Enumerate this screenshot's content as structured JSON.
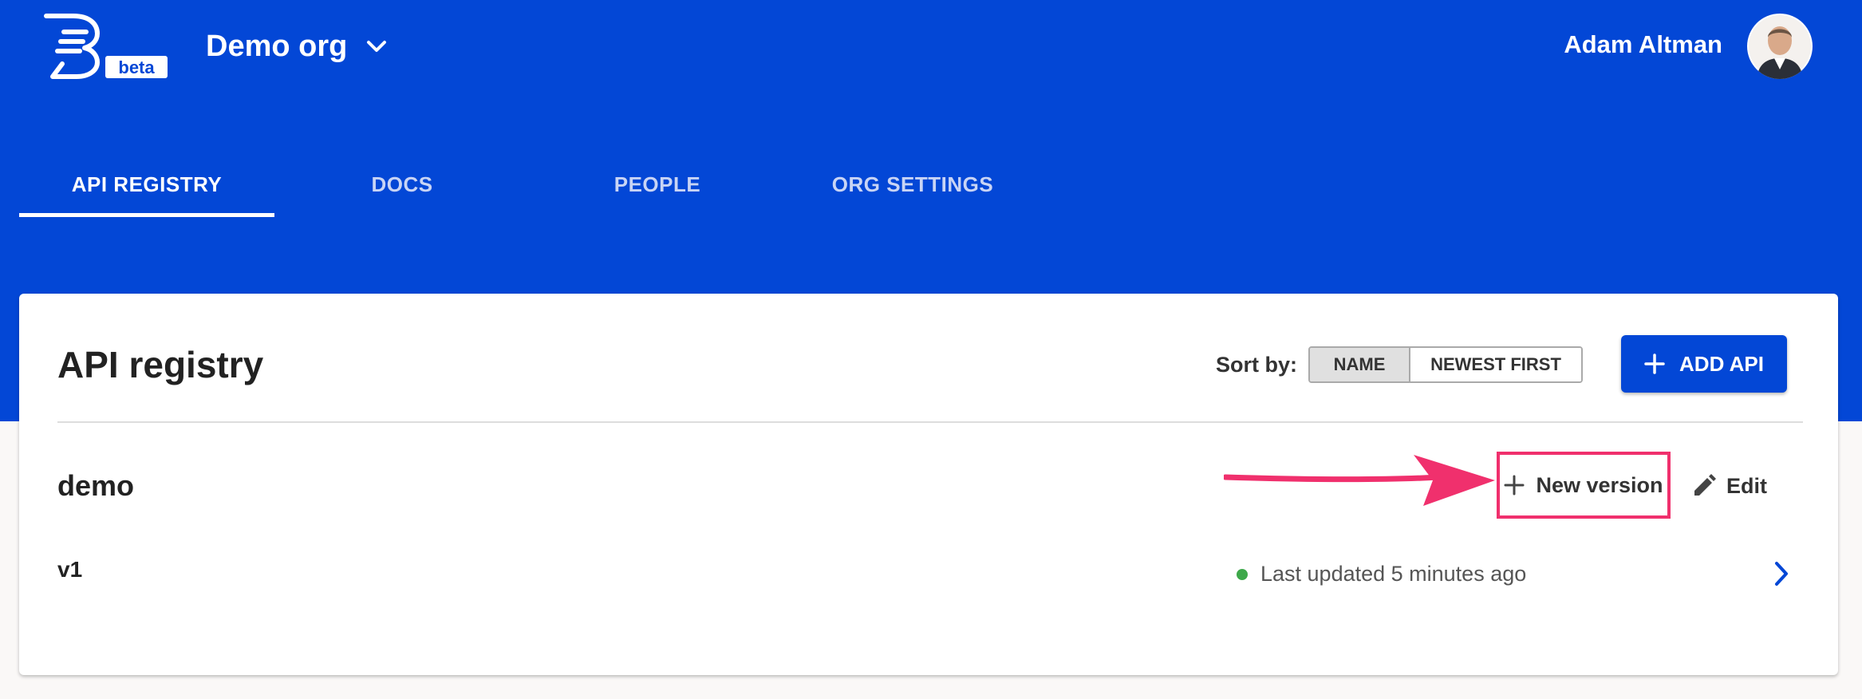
{
  "header": {
    "logo_badge": "beta",
    "org_name": "Demo org",
    "user_name": "Adam Altman"
  },
  "tabs": [
    {
      "label": "API REGISTRY",
      "active": true
    },
    {
      "label": "DOCS",
      "active": false
    },
    {
      "label": "PEOPLE",
      "active": false
    },
    {
      "label": "ORG SETTINGS",
      "active": false
    }
  ],
  "registry": {
    "title": "API registry",
    "sort_label": "Sort by:",
    "sort_options": [
      "NAME",
      "NEWEST FIRST"
    ],
    "sort_selected": "NAME",
    "add_button": "ADD API"
  },
  "api": {
    "name": "demo",
    "new_version_label": "New version",
    "edit_label": "Edit",
    "version": "v1",
    "status_text": "Last updated 5 minutes ago",
    "status_color": "#3ea84a"
  },
  "colors": {
    "brand_blue": "#0347d6",
    "highlight": "#f0306d"
  }
}
